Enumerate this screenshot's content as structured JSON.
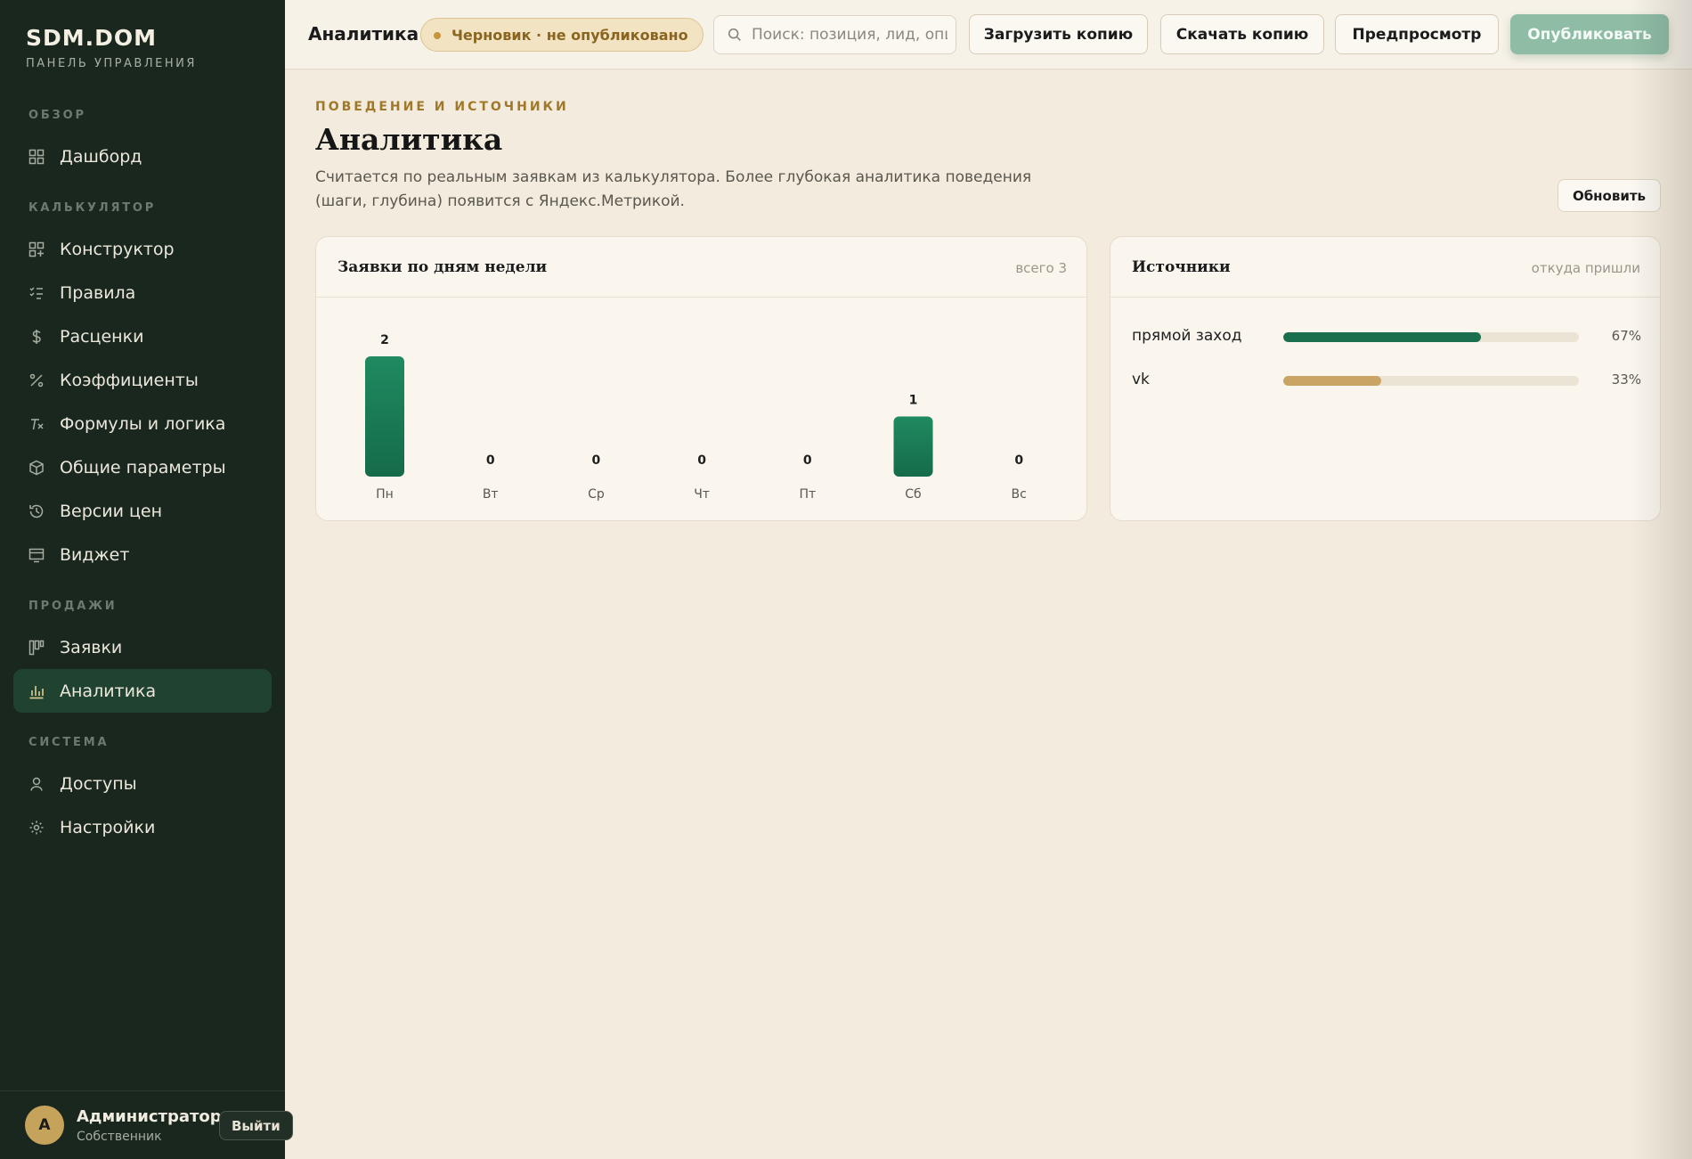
{
  "brand": {
    "name": "SDM.DOM",
    "subtitle": "ПАНЕЛЬ УПРАВЛЕНИЯ"
  },
  "nav": {
    "sections": [
      {
        "title": "ОБЗОР",
        "items": [
          {
            "label": "Дашборд",
            "icon": "dashboard-icon"
          }
        ]
      },
      {
        "title": "КАЛЬКУЛЯТОР",
        "items": [
          {
            "label": "Конструктор",
            "icon": "constructor-icon"
          },
          {
            "label": "Правила",
            "icon": "rules-icon"
          },
          {
            "label": "Расценки",
            "icon": "dollar-icon"
          },
          {
            "label": "Коэффициенты",
            "icon": "percent-icon"
          },
          {
            "label": "Формулы и логика",
            "icon": "formula-icon"
          },
          {
            "label": "Общие параметры",
            "icon": "box-icon"
          },
          {
            "label": "Версии цен",
            "icon": "history-icon"
          },
          {
            "label": "Виджет",
            "icon": "widget-icon"
          }
        ]
      },
      {
        "title": "ПРОДАЖИ",
        "items": [
          {
            "label": "Заявки",
            "icon": "kanban-icon"
          },
          {
            "label": "Аналитика",
            "icon": "bar-chart-icon",
            "active": true
          }
        ]
      },
      {
        "title": "СИСТЕМА",
        "items": [
          {
            "label": "Доступы",
            "icon": "user-icon"
          },
          {
            "label": "Настройки",
            "icon": "gear-icon"
          }
        ]
      }
    ]
  },
  "user": {
    "initial": "А",
    "name": "Администратор",
    "role": "Собственник",
    "logout": "Выйти"
  },
  "topbar": {
    "title": "Аналитика",
    "badge": "Черновик · не опубликовано",
    "search_placeholder": "Поиск: позиция, лид, опция",
    "upload": "Загрузить копию",
    "download": "Скачать копию",
    "preview": "Предпросмотр",
    "publish": "Опубликовать"
  },
  "page": {
    "eyebrow": "ПОВЕДЕНИЕ И ИСТОЧНИКИ",
    "title": "Аналитика",
    "description": "Считается по реальным заявкам из калькулятора. Более глубокая аналитика поведения (шаги, глубина) появится с Яндекс.Метрикой.",
    "refresh": "Обновить"
  },
  "days_card": {
    "title": "Заявки по дням недели",
    "meta": "всего 3"
  },
  "sources_card": {
    "title": "Источники",
    "meta": "откуда пришли",
    "items": [
      {
        "label": "прямой заход",
        "value": 0.67,
        "pct": "67%",
        "color": "#1b6e4e"
      },
      {
        "label": "vk",
        "value": 0.33,
        "pct": "33%",
        "color": "#c9a464"
      }
    ]
  },
  "chart_data": {
    "type": "bar",
    "categories": [
      "Пн",
      "Вт",
      "Ср",
      "Чт",
      "Пт",
      "Сб",
      "Вс"
    ],
    "values": [
      2,
      0,
      0,
      0,
      0,
      1,
      0
    ],
    "title": "Заявки по дням недели",
    "xlabel": "",
    "ylabel": "",
    "color": "#1b7a55",
    "grid": false
  }
}
